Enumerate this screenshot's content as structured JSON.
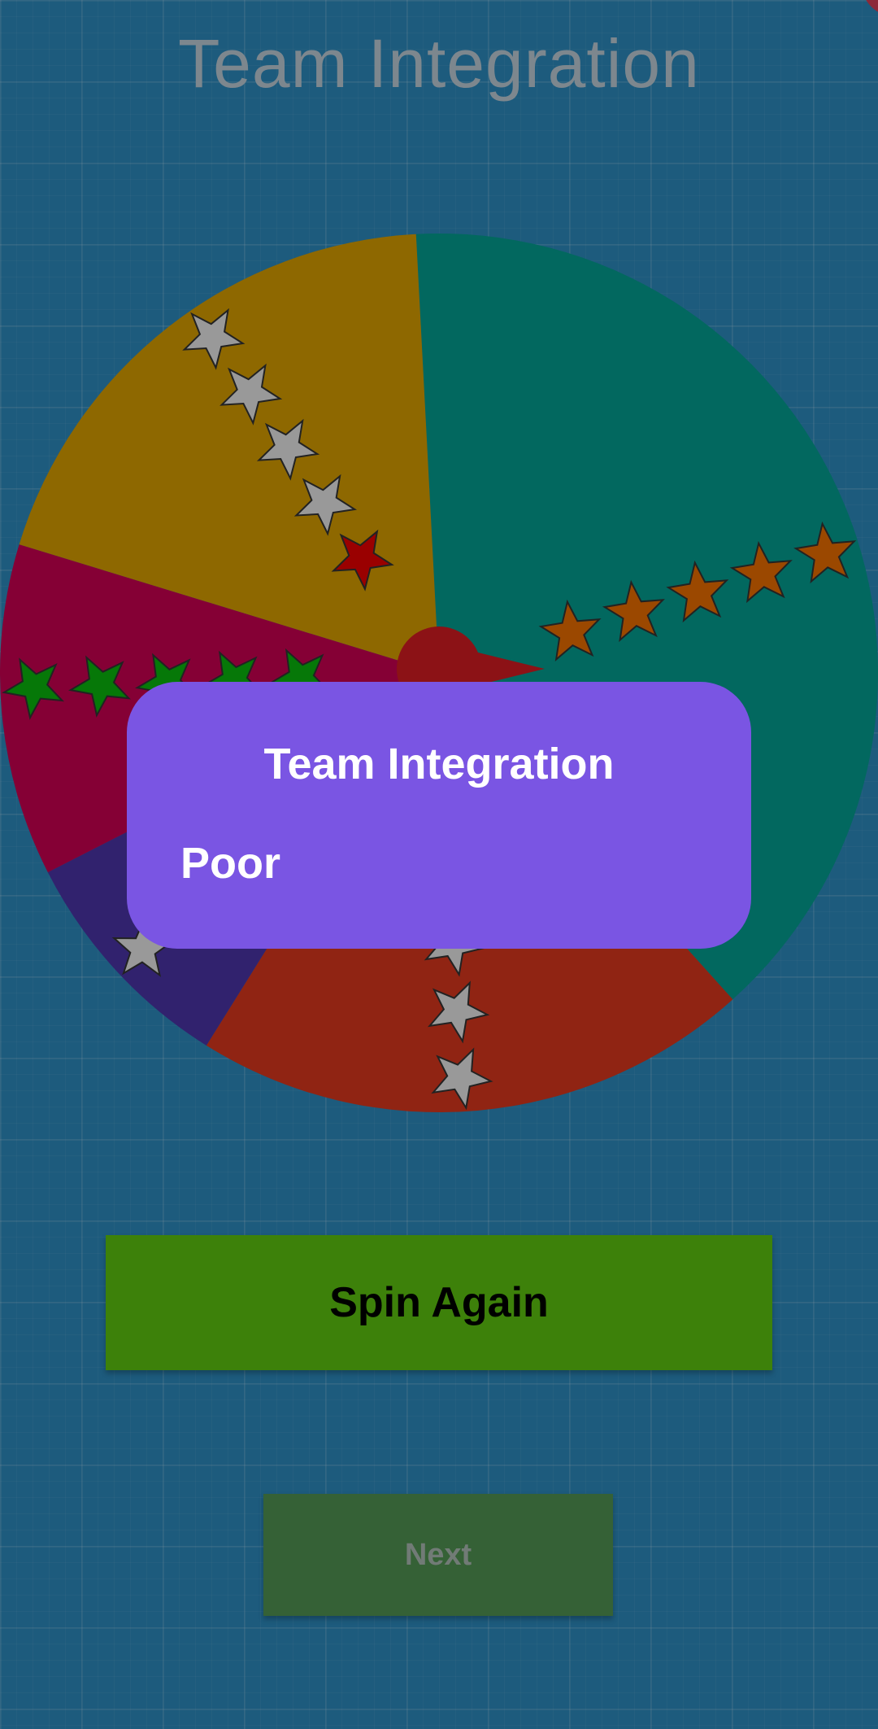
{
  "screen": {
    "title": "Team Integration"
  },
  "wheel": {
    "segments": [
      {
        "color": "#049a8c",
        "stars_filled": 5,
        "star_color": "#e56b00"
      },
      {
        "color": "#d4351c",
        "stars_filled": 0,
        "star_color": "#e2e2e2"
      },
      {
        "color": "#4933a2",
        "stars_filled": 0,
        "star_color": "#e2e2e2"
      },
      {
        "color": "#c5004e",
        "stars_filled": 5,
        "star_color": "#09b10d"
      },
      {
        "color": "#d29a00",
        "stars_filled": 1,
        "star_color": "#e30000"
      }
    ],
    "pointer_color": "#cf1b21"
  },
  "buttons": {
    "spin_again": "Spin Again",
    "next": "Next"
  },
  "dialog": {
    "title": "Team Integration",
    "value": "Poor"
  },
  "colors": {
    "background": "#2b86b8",
    "dialog": "#7a55e3",
    "spin_button": "#5bbf0f",
    "next_button": "#4f8f50"
  }
}
